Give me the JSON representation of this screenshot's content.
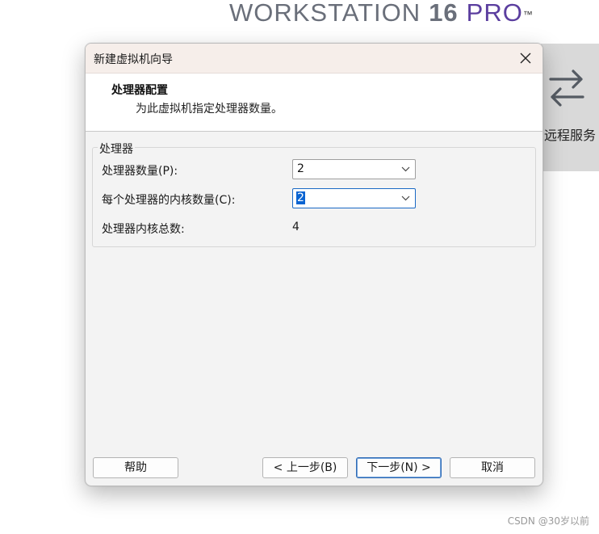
{
  "background_app": {
    "brand_word": "WORKSTATION",
    "brand_version": "16",
    "brand_edition": "PRO",
    "brand_tm": "™",
    "remote_tile_label": "远程服务",
    "watermark": "CSDN @30岁以前"
  },
  "dialog": {
    "title": "新建虚拟机向导",
    "header_title": "处理器配置",
    "header_subtitle": "为此虚拟机指定处理器数量。",
    "group_title": "处理器",
    "processor_count_label": "处理器数量(P):",
    "processor_count_value": "2",
    "cores_per_processor_label": "每个处理器的内核数量(C):",
    "cores_per_processor_value": "2",
    "total_cores_label": "处理器内核总数:",
    "total_cores_value": "4",
    "buttons": {
      "help": "帮助",
      "back": "< 上一步(B)",
      "next": "下一步(N) >",
      "cancel": "取消"
    }
  },
  "colors": {
    "brand_edition": "#5b3e9f",
    "titlebar": "#f6eeea",
    "selection": "#0a64d2",
    "focus_border": "#1a69c4"
  },
  "icons": [
    "swap-arrows-icon",
    "close-icon",
    "chevron-down-icon"
  ]
}
